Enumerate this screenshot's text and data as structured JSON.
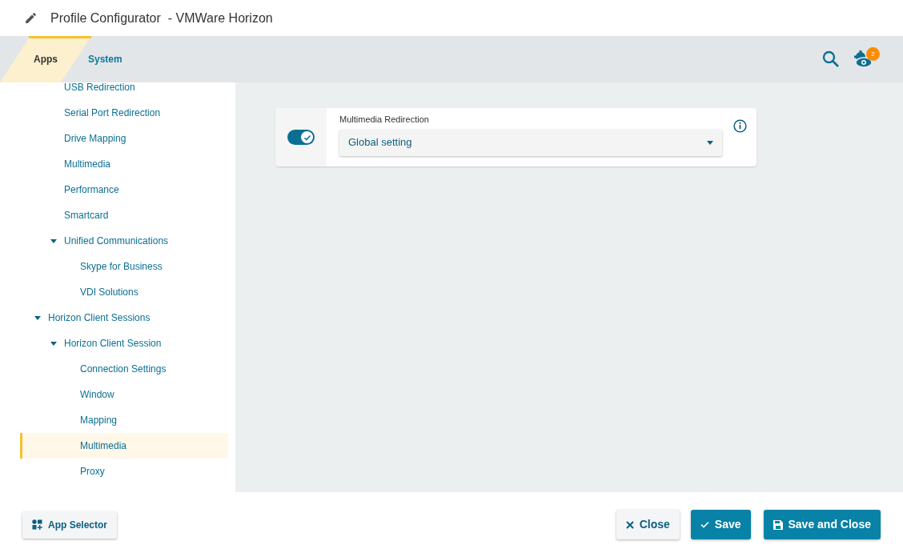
{
  "window": {
    "title": "Profile Configurator  - VMWare Horizon"
  },
  "tabs": [
    {
      "label": "Apps",
      "selected": true
    },
    {
      "label": "System",
      "selected": false
    }
  ],
  "toolbar": {
    "notification_count": "2"
  },
  "tree": [
    {
      "children": [
        {
          "label": "USB Redirection",
          "selected": false
        },
        {
          "label": "Serial Port Redirection",
          "selected": false
        },
        {
          "label": "Drive Mapping",
          "selected": false
        },
        {
          "label": "Multimedia",
          "selected": false
        },
        {
          "label": "Performance",
          "selected": false
        },
        {
          "label": "Smartcard",
          "selected": false
        },
        {
          "label": "Unified Communications",
          "selected": false,
          "expanded": true,
          "children": [
            {
              "label": "Skype for Business",
              "selected": false
            },
            {
              "label": "VDI Solutions",
              "selected": false
            }
          ]
        }
      ]
    },
    {
      "label": "Horizon Client Sessions",
      "selected": false,
      "expanded": true,
      "children": [
        {
          "label": "Horizon Client Session",
          "selected": false,
          "expanded": true,
          "children": [
            {
              "label": "Connection Settings",
              "selected": false
            },
            {
              "label": "Window",
              "selected": false
            },
            {
              "label": "Mapping",
              "selected": false
            },
            {
              "label": "Multimedia",
              "selected": true
            },
            {
              "label": "Proxy",
              "selected": false
            }
          ]
        }
      ]
    }
  ],
  "setting": {
    "label": "Multimedia Redirection",
    "enabled": true,
    "value": "Global setting"
  },
  "footer": {
    "left_button": "App Selector",
    "buttons": [
      {
        "label": "Close",
        "kind": "close"
      },
      {
        "label": "Save",
        "kind": "save"
      },
      {
        "label": "Save and Close",
        "kind": "saveclose"
      }
    ]
  }
}
